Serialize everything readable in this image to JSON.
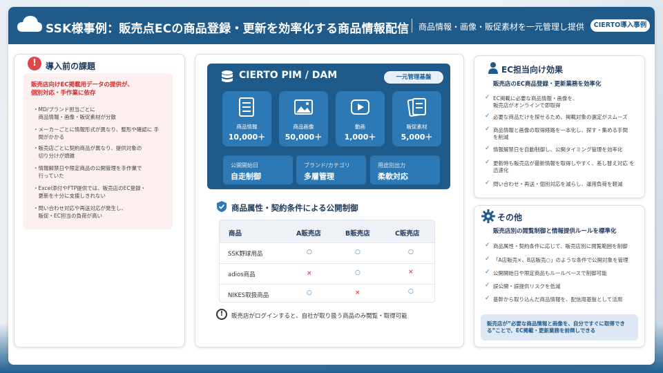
{
  "header": {
    "title": "SSK様事例：販売点ECの商品登録・更新を効率化する商品情報配信",
    "subtitle": "商品情報・画像・販促素材を一元管理し提供",
    "badge": "CIERTO導入事例"
  },
  "left": {
    "title": "導入前の課題",
    "lead_line1": "販売店向けEC掲載用データの提供が、",
    "lead_line2": "個別対応・手作業に依存",
    "bullets": [
      [
        "・MD/ブランド担当ごとに",
        "　商品情報・画像・販促素材が分散"
      ],
      [
        "・メーカーごとに情報形式が異なり、整形や確認に 手",
        "　間がかかる"
      ],
      [
        "・販売店ごとに契約商品が異なり、提供対象の",
        "　切り分けが煩雑"
      ],
      [
        "・情報解禁日や限定商品の公開管理を手作業で",
        "　行っていた"
      ],
      [
        "・Excel添付やFTP提供では、販売店のEC登録・",
        "　更新を十分に支援しきれない"
      ],
      [
        "・問い合わせ対応や再送対応が発生し、",
        "　販促・EC担当の負荷が高い"
      ]
    ]
  },
  "pim": {
    "title": "CIERTO PIM / DAM",
    "badge": "一元管理基盤",
    "tiles": [
      {
        "icon": "list-icon",
        "label": "商品情報",
        "value": "10,000＋"
      },
      {
        "icon": "image-icon",
        "label": "商品画像",
        "value": "50,000＋"
      },
      {
        "icon": "video-icon",
        "label": "動画",
        "value": "1,000＋"
      },
      {
        "icon": "document-icon",
        "label": "販促素材",
        "value": "5,000＋"
      }
    ],
    "features": [
      {
        "label": "公開開始日",
        "value": "自走制御"
      },
      {
        "label": "ブランド/カテゴリ",
        "value": "多層管理"
      },
      {
        "label": "用途別出力",
        "value": "柔軟対応"
      }
    ]
  },
  "table": {
    "title": "商品属性・契約条件による公開制御",
    "headers": [
      "商品",
      "A販売店",
      "B販売店",
      "C販売店"
    ],
    "rows": [
      {
        "name": "SSK野球用品",
        "cells": [
          "○",
          "○",
          "○"
        ]
      },
      {
        "name": "adios商品",
        "cells": [
          "×",
          "○",
          "×"
        ]
      },
      {
        "name": "NIKES取扱商品",
        "cells": [
          "○",
          "×",
          "○"
        ]
      }
    ],
    "note": "販売店がログインすると、自社が取り扱う商品のみ閲覧・取得可能"
  },
  "ec": {
    "title": "EC担当向け効果",
    "lead": "販売店のEC商品登録・更新業務を効率化",
    "items": [
      [
        "EC掲載に必要な商品情報・画像を、",
        "販売店がオンラインで即取得"
      ],
      [
        "必要な商品だけを探せるため、掲載対象の選定がスムーズ"
      ],
      [
        "商品情報と画像の取得経路を一本化し、探す・集める手間",
        "を削減"
      ],
      [
        "情報解禁日を自動制御し、公開タイミング管理を効率化"
      ],
      [
        "更新時も販売店が最新情報を取得しやすく、差し替え対応 を",
        "迅速化"
      ],
      [
        "問い合わせ・再送・個別対応を減らし、運用負荷を軽減"
      ]
    ]
  },
  "other": {
    "title": "その他",
    "lead": "販売店別の閲覧制御と情報提供ルールを標準化",
    "items": [
      [
        "商品属性・契約条件に応じて、販売店別に閲覧範囲を制御"
      ],
      [
        "「A店販売×、B店販売○」のような条件で公開対象を管理"
      ],
      [
        "公開開始日や限定商品もルールベースで制御可能"
      ],
      [
        "誤公開・誤提供リスクを低減"
      ],
      [
        "基幹から取り込んだ商品情報を、配信用基盤として活用"
      ]
    ],
    "callout_line1": "販売店が”必要な商品情報と画像を、自分ですぐに取得でき",
    "callout_line2": "る”ことで、EC掲載・更新業務を前倒しできる"
  },
  "colors": {
    "brand": "#1e5a8a",
    "accent": "#2d79b5",
    "alert": "#e04848"
  }
}
